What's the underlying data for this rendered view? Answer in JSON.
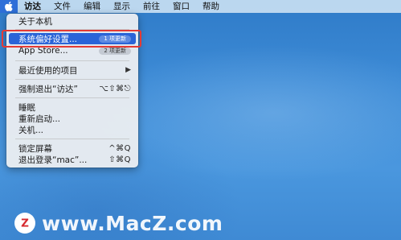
{
  "menubar": {
    "items": [
      {
        "label": "访达",
        "bold": true
      },
      {
        "label": "文件"
      },
      {
        "label": "编辑"
      },
      {
        "label": "显示"
      },
      {
        "label": "前往"
      },
      {
        "label": "窗口"
      },
      {
        "label": "帮助"
      }
    ]
  },
  "apple_menu": {
    "about": "关于本机",
    "system_prefs": "系统偏好设置...",
    "system_prefs_badge": "1 项更新",
    "app_store": "App Store...",
    "app_store_badge": "2 项更新",
    "recent_items": "最近使用的项目",
    "submenu_arrow": "▶",
    "force_quit": "强制退出“访达”",
    "force_quit_shortcut": "⌥⇧⌘⎋",
    "sleep": "睡眠",
    "restart": "重新启动...",
    "shutdown": "关机...",
    "lock_screen": "锁定屏幕",
    "lock_screen_shortcut": "^⌘Q",
    "logout": "退出登录“mac”...",
    "logout_shortcut": "⇧⌘Q"
  },
  "watermark": {
    "text": "www.MacZ.com",
    "logo_letter": "Z"
  },
  "colors": {
    "selection": "#2a64d8",
    "highlight_border": "#e53a34",
    "desktop": "#3d8bd6"
  }
}
